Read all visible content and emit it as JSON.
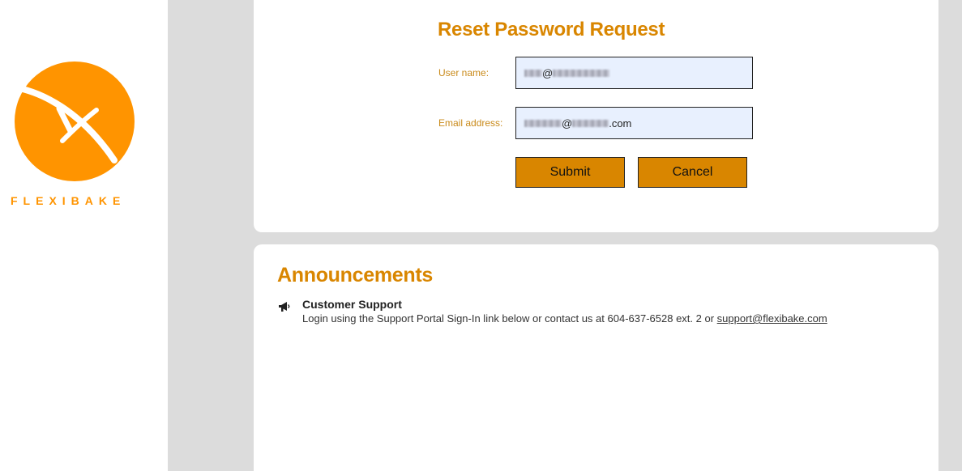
{
  "brand": {
    "name": "FLEXIBAKE",
    "accent_color": "#d98600",
    "logo_color": "#ff9400"
  },
  "reset_form": {
    "title": "Reset Password Request",
    "username_label": "User name:",
    "username_value_visible": "@",
    "email_label": "Email address:",
    "email_value_visible_at": "@",
    "email_value_visible_suffix": ".com",
    "submit_label": "Submit",
    "cancel_label": "Cancel"
  },
  "announcements": {
    "title": "Announcements",
    "items": [
      {
        "icon": "megaphone-icon",
        "title": "Customer Support",
        "body": "Login using the Support Portal Sign-In link below or contact us at 604-637-6528 ext. 2 or",
        "link_text": "support@flexibake.com"
      }
    ]
  }
}
